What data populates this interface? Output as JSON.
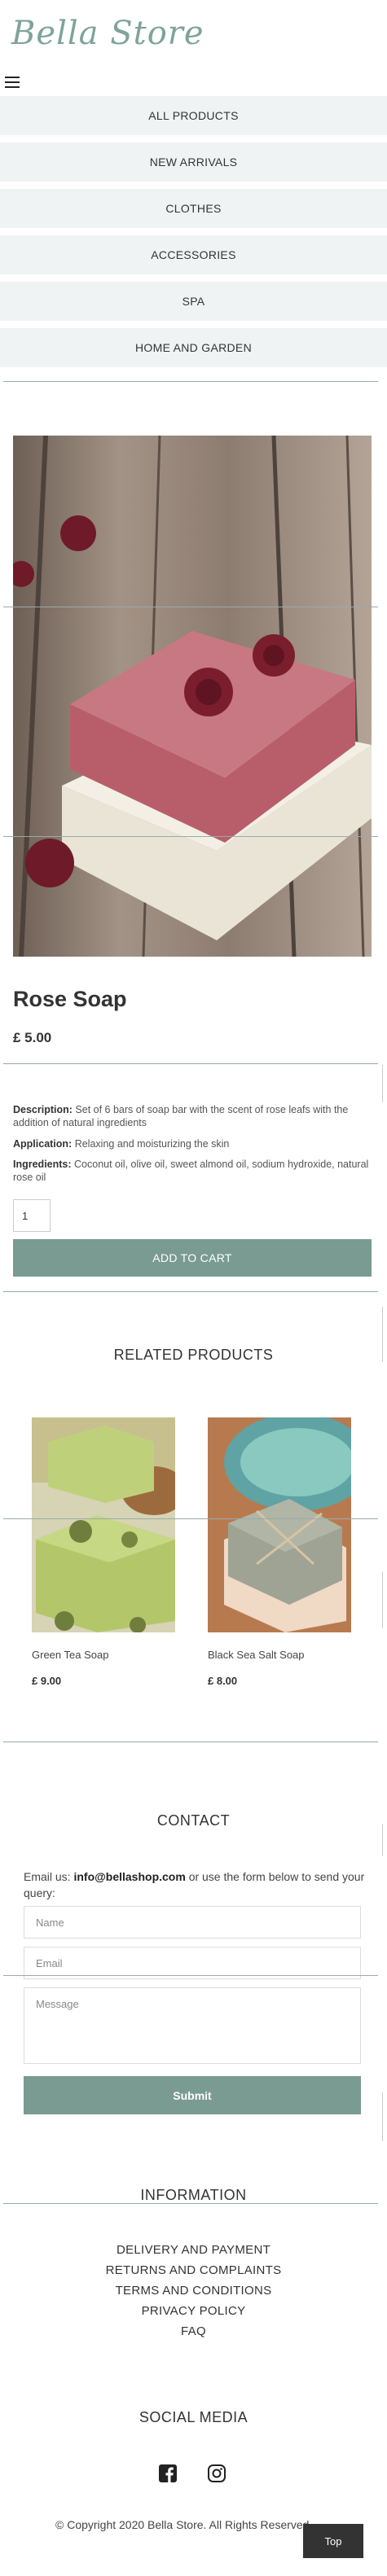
{
  "header": {
    "logo_text": "Bella Store"
  },
  "menu": {
    "items": [
      {
        "label": "ALL PRODUCTS"
      },
      {
        "label": "NEW ARRIVALS"
      },
      {
        "label": "CLOTHES"
      },
      {
        "label": "ACCESSORIES"
      },
      {
        "label": "SPA"
      },
      {
        "label": "HOME AND GARDEN"
      }
    ]
  },
  "product": {
    "name": "Rose Soap",
    "price": "£ 5.00",
    "description_label": "Description:",
    "description": "Set of 6 bars of soap bar with the scent of rose leafs with the addition of natural ingredients",
    "application_label": "Application:",
    "application": "Relaxing and moisturizing the skin",
    "ingredients_label": "Ingredients:",
    "ingredients": "Coconut oil, olive oil, sweet almond oil, sodium hydroxide, natural rose oil",
    "quantity": "1",
    "add_to_cart_label": "ADD TO CART"
  },
  "related": {
    "title": "RELATED PRODUCTS",
    "items": [
      {
        "name": "Green Tea Soap",
        "price": "£ 9.00"
      },
      {
        "name": "Black Sea Salt Soap",
        "price": "£ 8.00"
      }
    ]
  },
  "contact": {
    "title": "CONTACT",
    "text_prefix": "Email us:",
    "email": "info@bellashop.com",
    "text_suffix": "or use the form below to send your query:",
    "name_placeholder": "Name",
    "email_placeholder": "Email",
    "message_placeholder": "Message",
    "submit_label": "Submit"
  },
  "information": {
    "title": "INFORMATION",
    "links": [
      {
        "label": "DELIVERY AND PAYMENT"
      },
      {
        "label": "RETURNS AND COMPLAINTS"
      },
      {
        "label": "TERMS AND CONDITIONS"
      },
      {
        "label": "PRIVACY POLICY"
      },
      {
        "label": "FAQ"
      }
    ]
  },
  "social": {
    "title": "SOCIAL MEDIA",
    "icons": [
      "facebook-icon",
      "instagram-icon"
    ]
  },
  "footer": {
    "copyright": "© Copyright 2020 Bella Store. All Rights Reserved",
    "top_label": "Top"
  },
  "colors": {
    "accent": "#7a9b91",
    "menu_bg": "#f0f3f4",
    "logo": "#7fa39a"
  }
}
